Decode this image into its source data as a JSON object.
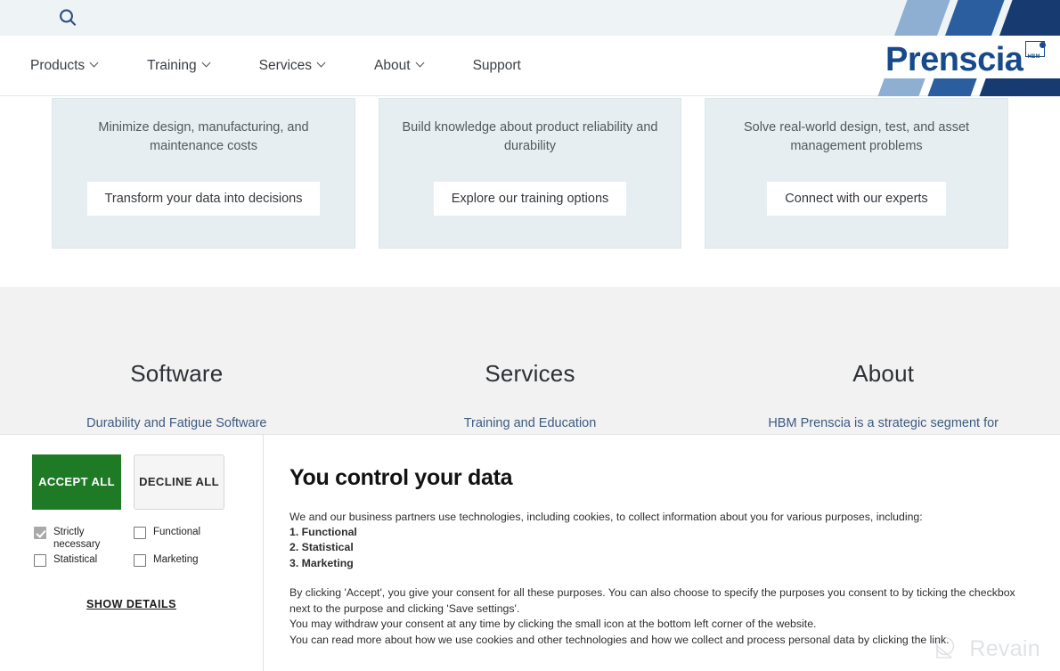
{
  "topbar": {
    "search_icon": "search-icon"
  },
  "nav": {
    "items": [
      {
        "label": "Products",
        "has_caret": true
      },
      {
        "label": "Training",
        "has_caret": true
      },
      {
        "label": "Services",
        "has_caret": true
      },
      {
        "label": "About",
        "has_caret": true
      },
      {
        "label": "Support",
        "has_caret": false
      }
    ]
  },
  "logo": {
    "wordmark": "Prenscia",
    "mark_label": "HBM",
    "colors": {
      "light_blue": "#8eaed2",
      "mid_blue": "#2a5e9e",
      "dark_blue": "#173a70",
      "wordmark": "#174a8b"
    }
  },
  "cards": [
    {
      "text": "Minimize design, manufacturing, and maintenance costs",
      "button": "Transform your data into decisions"
    },
    {
      "text": "Build knowledge about product reliability and durability",
      "button": "Explore our training options"
    },
    {
      "text": "Solve real-world design, test, and asset management problems",
      "button": "Connect with our experts"
    }
  ],
  "footer": {
    "columns": [
      {
        "heading": "Software",
        "link": "Durability and Fatigue Software"
      },
      {
        "heading": "Services",
        "link": "Training and Education"
      },
      {
        "heading": "About",
        "link": "HBM Prenscia is a strategic segment for"
      }
    ]
  },
  "cookie": {
    "accept_label": "ACCEPT ALL",
    "decline_label": "DECLINE ALL",
    "consents": [
      {
        "label": "Strictly necessary",
        "checked": true,
        "disabled": true
      },
      {
        "label": "Functional",
        "checked": false,
        "disabled": false
      },
      {
        "label": "Statistical",
        "checked": false,
        "disabled": false
      },
      {
        "label": "Marketing",
        "checked": false,
        "disabled": false
      }
    ],
    "show_details": "SHOW DETAILS",
    "title": "You control your data",
    "intro": "We and our business partners use technologies, including cookies, to collect information about you for various purposes, including:",
    "purposes": [
      "1. Functional",
      "2. Statistical",
      "3. Marketing"
    ],
    "paragraph_1": "By clicking 'Accept', you give your consent for all these purposes. You can also choose to specify the purposes you consent to by ticking the checkbox next to the purpose and clicking 'Save settings'.",
    "paragraph_2": "You may withdraw your consent at any time by clicking the small icon at the bottom left corner of the website.",
    "paragraph_3": "You can read more about how we use cookies and other technologies and how we collect and process personal data by clicking the link.",
    "accept_color": "#1f7a26"
  },
  "watermark": {
    "text": "Revain"
  }
}
